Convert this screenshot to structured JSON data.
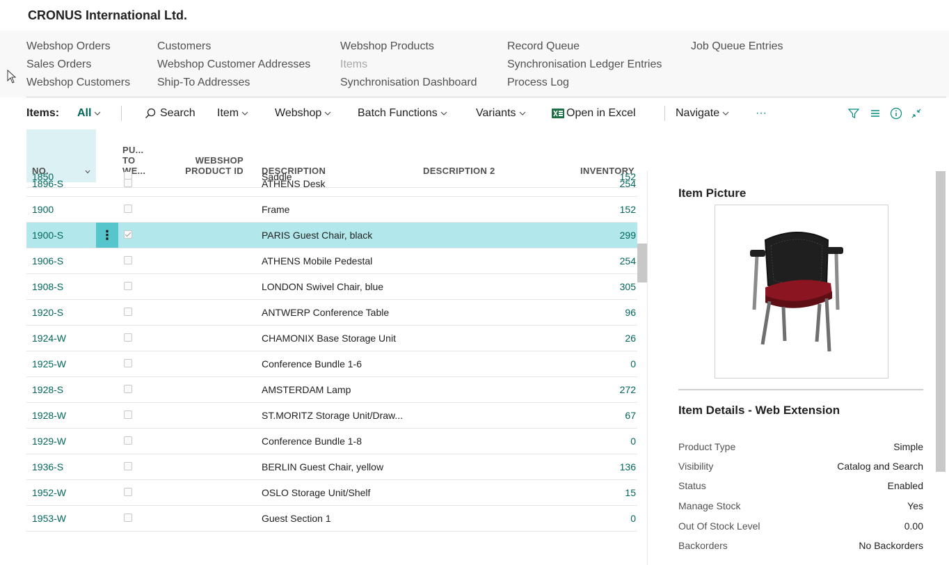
{
  "company": "CRONUS International Ltd.",
  "nav": {
    "col1": [
      "Webshop Orders",
      "Sales Orders",
      "Webshop Customers"
    ],
    "col2": [
      "Customers",
      "Webshop Customer Addresses",
      "Ship-To Addresses"
    ],
    "col3": [
      "Webshop Products",
      "Items",
      "Synchronisation Dashboard"
    ],
    "col4": [
      "Record Queue",
      "Synchronisation Ledger Entries",
      "Process Log"
    ],
    "col5": [
      "Job Queue Entries"
    ]
  },
  "actions": {
    "items_label": "Items:",
    "view": "All",
    "search": "Search",
    "item": "Item",
    "webshop": "Webshop",
    "batch": "Batch Functions",
    "variants": "Variants",
    "excel": "Open in Excel",
    "navigate": "Navigate",
    "more": "···"
  },
  "columns": {
    "no": "NO.",
    "push1": "PU...",
    "push2": "TO",
    "push3": "WE...",
    "pid1": "WEBSHOP",
    "pid2": "PRODUCT ID",
    "description": "DESCRIPTION",
    "description2": "DESCRIPTION 2",
    "inventory": "INVENTORY"
  },
  "rows": [
    {
      "no": "1850",
      "desc": "Saddle",
      "inv": "152",
      "checked": false
    },
    {
      "no": "1896-S",
      "desc": "ATHENS Desk",
      "inv": "254",
      "checked": false
    },
    {
      "no": "1900",
      "desc": "Frame",
      "inv": "152",
      "checked": false
    },
    {
      "no": "1900-S",
      "desc": "PARIS Guest Chair, black",
      "inv": "299",
      "checked": true,
      "selected": true
    },
    {
      "no": "1906-S",
      "desc": "ATHENS Mobile Pedestal",
      "inv": "254",
      "checked": false
    },
    {
      "no": "1908-S",
      "desc": "LONDON Swivel Chair, blue",
      "inv": "305",
      "checked": false
    },
    {
      "no": "1920-S",
      "desc": "ANTWERP Conference Table",
      "inv": "96",
      "checked": false
    },
    {
      "no": "1924-W",
      "desc": "CHAMONIX Base Storage Unit",
      "inv": "26",
      "checked": false
    },
    {
      "no": "1925-W",
      "desc": "Conference Bundle 1-6",
      "inv": "0",
      "checked": false
    },
    {
      "no": "1928-S",
      "desc": "AMSTERDAM Lamp",
      "inv": "272",
      "checked": false
    },
    {
      "no": "1928-W",
      "desc": "ST.MORITZ Storage Unit/Draw...",
      "inv": "67",
      "checked": false
    },
    {
      "no": "1929-W",
      "desc": "Conference Bundle 1-8",
      "inv": "0",
      "checked": false
    },
    {
      "no": "1936-S",
      "desc": "BERLIN Guest Chair, yellow",
      "inv": "136",
      "checked": false
    },
    {
      "no": "1952-W",
      "desc": "OSLO Storage Unit/Shelf",
      "inv": "15",
      "checked": false
    },
    {
      "no": "1953-W",
      "desc": "Guest Section 1",
      "inv": "0",
      "checked": false
    }
  ],
  "row_menu": "⋮",
  "factbox": {
    "picture_title": "Item Picture",
    "details_title": "Item Details - Web Extension",
    "details": [
      {
        "label": "Product Type",
        "value": "Simple"
      },
      {
        "label": "Visibility",
        "value": "Catalog and Search"
      },
      {
        "label": "Status",
        "value": "Enabled"
      },
      {
        "label": "Manage Stock",
        "value": "Yes"
      },
      {
        "label": "Out Of Stock Level",
        "value": "0.00"
      },
      {
        "label": "Backorders",
        "value": "No Backorders"
      }
    ]
  },
  "colors": {
    "accent": "#00665b",
    "selected_row": "#b2e8ec",
    "header_select": "#dbf1f3"
  }
}
